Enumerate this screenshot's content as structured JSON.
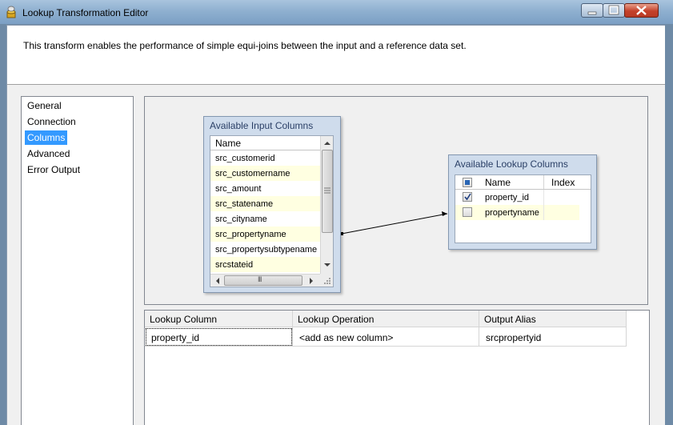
{
  "window": {
    "title": "Lookup Transformation Editor"
  },
  "description": "This transform enables the performance of simple equi-joins between the input and a reference data set.",
  "nav": {
    "items": [
      {
        "label": "General",
        "selected": false
      },
      {
        "label": "Connection",
        "selected": false
      },
      {
        "label": "Columns",
        "selected": true
      },
      {
        "label": "Advanced",
        "selected": false
      },
      {
        "label": "Error Output",
        "selected": false
      }
    ]
  },
  "input_columns": {
    "title": "Available Input Columns",
    "header": "Name",
    "rows": [
      "src_customerid",
      "src_customername",
      "src_amount",
      "src_statename",
      "src_cityname",
      "src_propertyname",
      "src_propertysubtypename",
      "srcstateid"
    ],
    "scroll_glyph": "III"
  },
  "lookup_columns": {
    "title": "Available Lookup Columns",
    "header_name": "Name",
    "header_index": "Index",
    "rows": [
      {
        "name": "property_id",
        "checked": true
      },
      {
        "name": "propertyname",
        "checked": false
      }
    ]
  },
  "mapping": {
    "headers": [
      "Lookup Column",
      "Lookup Operation",
      "Output Alias"
    ],
    "rows": [
      [
        "property_id",
        "<add as new column>",
        "srcpropertyid"
      ]
    ]
  },
  "colors": {
    "selection": "#3399ff",
    "alt_row": "#ffffe1",
    "box_bg": "#cfdcec",
    "box_title": "#2a3f66"
  }
}
